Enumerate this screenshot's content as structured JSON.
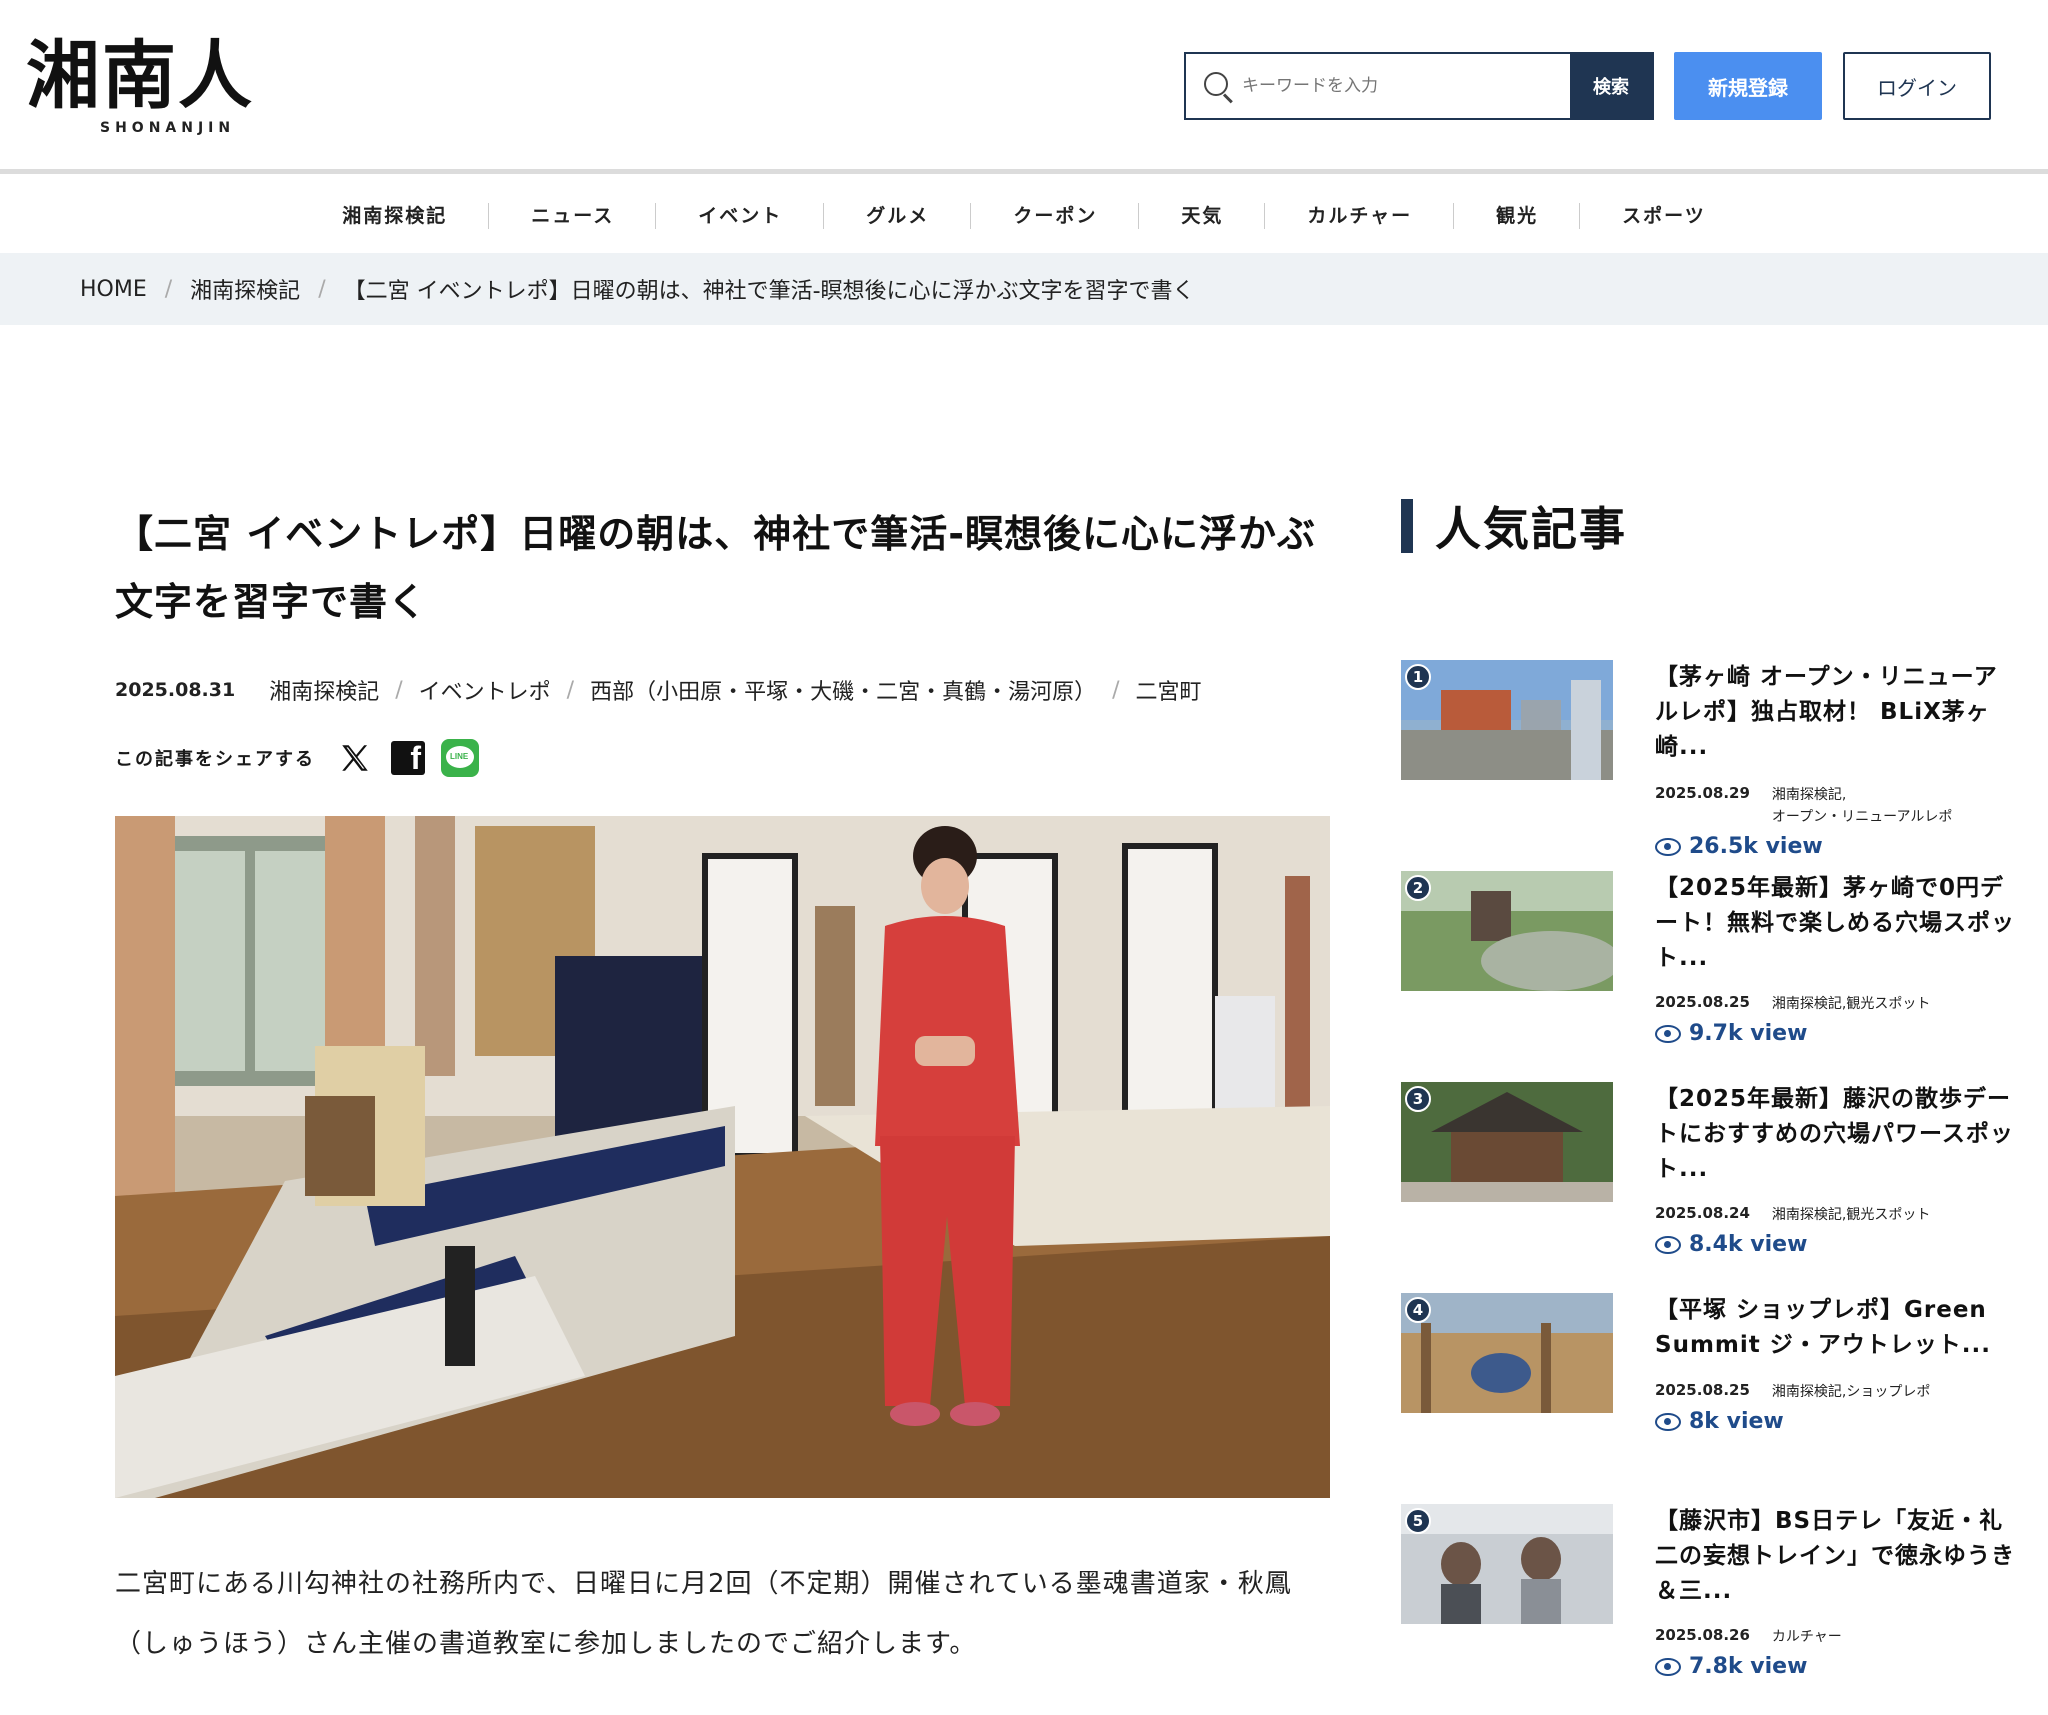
{
  "header": {
    "logo_jp": "湘南人",
    "logo_en": "SHONANJIN",
    "search_placeholder": "キーワードを入力",
    "search_button": "検索",
    "register_button": "新規登録",
    "login_button": "ログイン"
  },
  "nav": [
    "湘南探検記",
    "ニュース",
    "イベント",
    "グルメ",
    "クーポン",
    "天気",
    "カルチャー",
    "観光",
    "スポーツ"
  ],
  "breadcrumb": [
    "HOME",
    "湘南探検記",
    "【二宮 イベントレポ】日曜の朝は、神社で筆活-瞑想後に心に浮かぶ文字を習字で書く"
  ],
  "article": {
    "title": "【二宮 イベントレポ】日曜の朝は、神社で筆活-瞑想後に心に浮かぶ文字を習字で書く",
    "date": "2025.08.31",
    "categories": [
      "湘南探検記",
      "イベントレポ",
      "西部（小田原・平塚・大磯・二宮・真鶴・湯河原）",
      "二宮町"
    ],
    "share_label": "この記事をシェアする",
    "lead": "二宮町にある川勾神社の社務所内で、日曜日に月2回（不定期）開催されている墨魂書道家・秋鳳（しゅうほう）さん主催の書道教室に参加しましたのでご紹介します。"
  },
  "sidebar": {
    "title": "人気記事",
    "items": [
      {
        "rank": "1",
        "title": "【茅ヶ崎 オープン・リニューアルレポ】独占取材！ BLiX茅ヶ崎...",
        "date": "2025.08.29",
        "category": "湘南探検記,",
        "category2": "オープン・リニューアルレポ",
        "views": "26.5k view"
      },
      {
        "rank": "2",
        "title": "【2025年最新】茅ヶ崎で0円デート！無料で楽しめる穴場スポット...",
        "date": "2025.08.25",
        "category": "湘南探検記,観光スポット",
        "category2": "",
        "views": "9.7k view"
      },
      {
        "rank": "3",
        "title": "【2025年最新】藤沢の散歩デートにおすすめの穴場パワースポット...",
        "date": "2025.08.24",
        "category": "湘南探検記,観光スポット",
        "category2": "",
        "views": "8.4k view"
      },
      {
        "rank": "4",
        "title": "【平塚 ショップレポ】Green Summit ジ・アウトレット...",
        "date": "2025.08.25",
        "category": "湘南探検記,ショップレポ",
        "category2": "",
        "views": "8k view"
      },
      {
        "rank": "5",
        "title": "【藤沢市】BS日テレ「友近・礼二の妄想トレイン」で徳永ゆうき＆三...",
        "date": "2025.08.26",
        "category": "カルチャー",
        "category2": "",
        "views": "7.8k view"
      }
    ]
  }
}
